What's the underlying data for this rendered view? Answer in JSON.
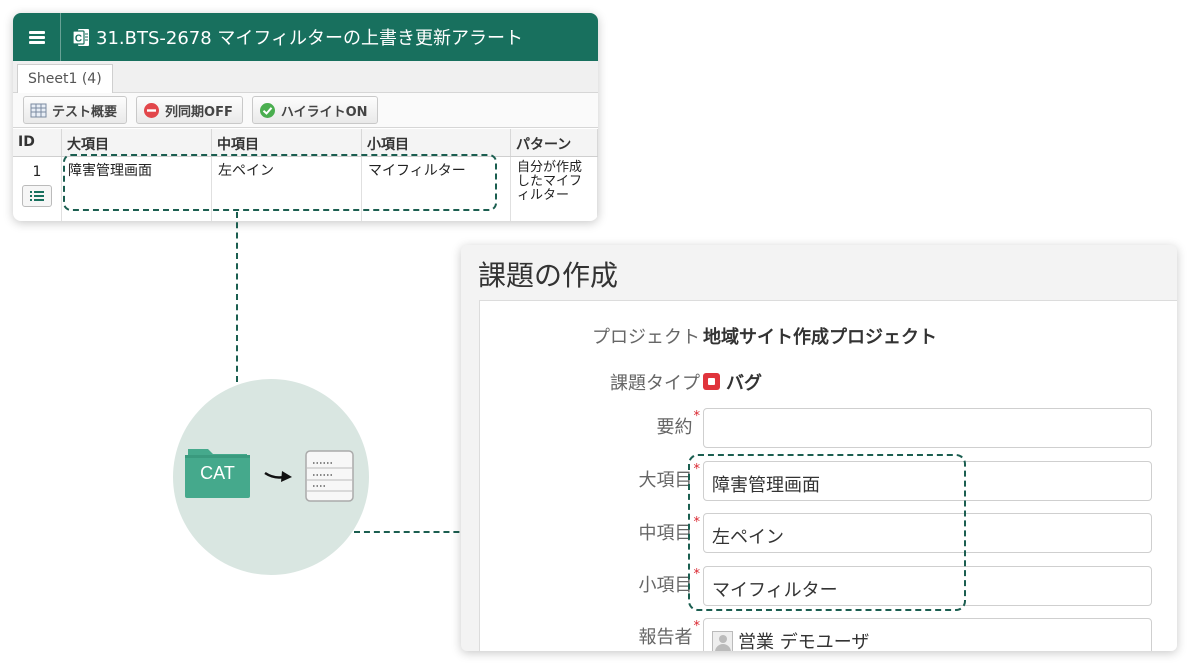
{
  "sheet": {
    "title": "31.BTS-2678 マイフィルターの上書き更新アラート",
    "tab_label": "Sheet1 (4)",
    "toolbar": {
      "overview_label": "テスト概要",
      "sync_off_label": "列同期OFF",
      "highlight_on_label": "ハイライトON"
    },
    "columns": [
      "ID",
      "大項目",
      "中項目",
      "小項目",
      "パターン"
    ],
    "row": {
      "id": "1",
      "major": "障害管理画面",
      "middle": "左ペイン",
      "minor": "マイフィルター",
      "pattern": "自分が作成したマイフィルター"
    }
  },
  "converter": {
    "folder_label": "CAT"
  },
  "issue": {
    "title": "課題の作成",
    "fields": {
      "project_label": "プロジェクト",
      "project_value": "地域サイト作成プロジェクト",
      "type_label": "課題タイプ",
      "type_value": "バグ",
      "summary_label": "要約",
      "summary_value": "",
      "major_label": "大項目",
      "major_value": "障害管理画面",
      "middle_label": "中項目",
      "middle_value": "左ペイン",
      "minor_label": "小項目",
      "minor_value": "マイフィルター",
      "reporter_label": "報告者",
      "reporter_value": "営業 デモユーザ",
      "required_mark": "*"
    }
  },
  "colors": {
    "header_green": "#18705e",
    "dash_green": "#1b5e50",
    "circle_bg": "#d9e6e1",
    "folder_green": "#45a98c",
    "required_red": "#d9232d"
  }
}
